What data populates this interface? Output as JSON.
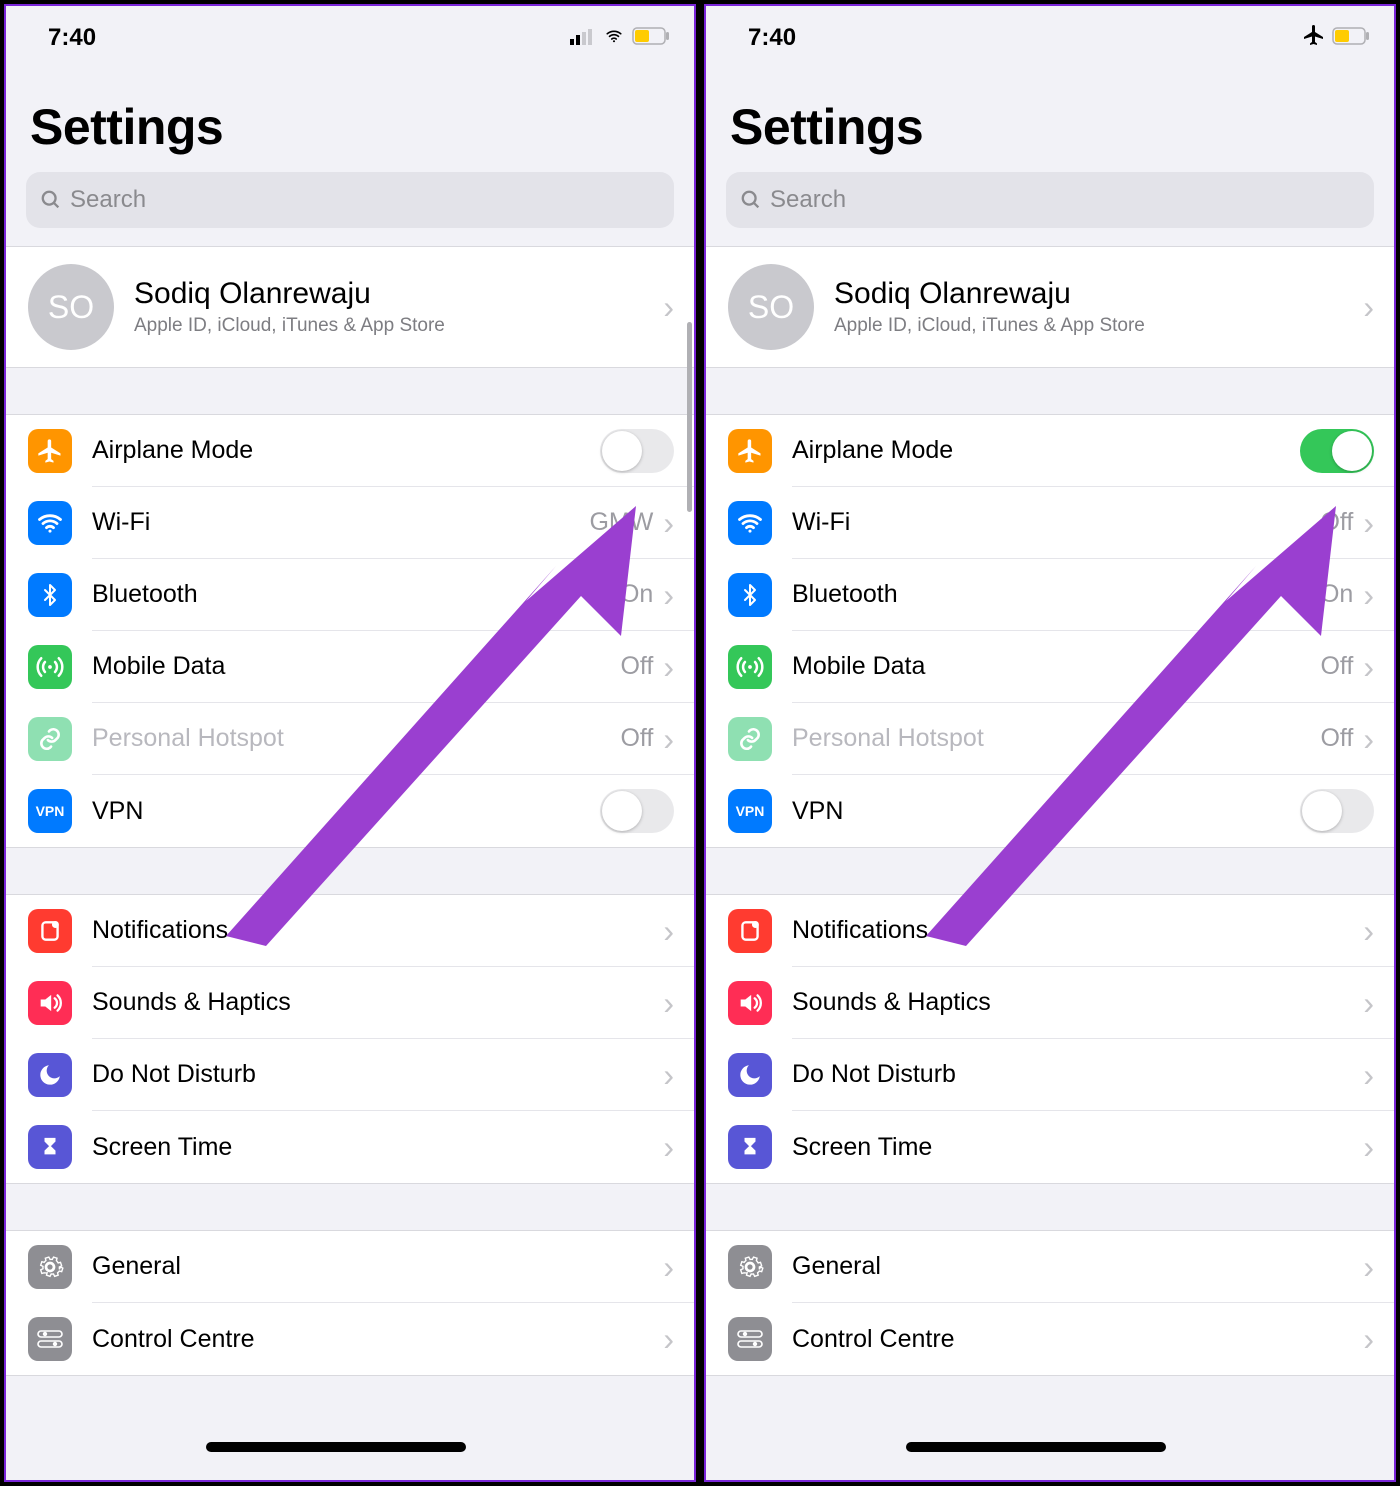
{
  "status_time": "7:40",
  "page_title": "Settings",
  "search_placeholder": "Search",
  "profile": {
    "initials": "SO",
    "name": "Sodiq Olanrewaju",
    "subtitle": "Apple ID, iCloud, iTunes & App Store"
  },
  "screens": [
    {
      "status_mode": "normal",
      "airplane_on": false,
      "wifi_value": "GMW",
      "bluetooth_value": "On",
      "mobile_value": "Off",
      "hotspot_value": "Off"
    },
    {
      "status_mode": "airplane",
      "airplane_on": true,
      "wifi_value": "Off",
      "bluetooth_value": "On",
      "mobile_value": "Off",
      "hotspot_value": "Off"
    }
  ],
  "labels": {
    "airplane": "Airplane Mode",
    "wifi": "Wi-Fi",
    "bluetooth": "Bluetooth",
    "mobile": "Mobile Data",
    "hotspot": "Personal Hotspot",
    "vpn": "VPN",
    "notifications": "Notifications",
    "sounds": "Sounds & Haptics",
    "dnd": "Do Not Disturb",
    "screentime": "Screen Time",
    "general": "General",
    "control": "Control Centre"
  },
  "vpn_badge": "VPN",
  "colors": {
    "orange": "#ff9500",
    "blue": "#007aff",
    "green": "#34c759",
    "greenlight": "#8fe0b2",
    "red": "#ff3b30",
    "red2": "#ff2d55",
    "purple": "#5856d6",
    "gray": "#8e8e93",
    "arrow": "#9a3fd0"
  }
}
